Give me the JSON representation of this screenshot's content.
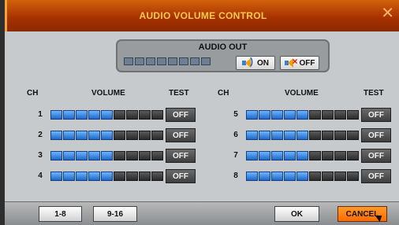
{
  "window": {
    "title": "AUDIO VOLUME CONTROL",
    "close_label": "✕"
  },
  "audio_out": {
    "label": "AUDIO OUT",
    "segments_total": 8,
    "segments_on": 0,
    "on_label": "ON",
    "off_label": "OFF"
  },
  "headers": {
    "ch": "CH",
    "volume": "VOLUME",
    "test": "TEST"
  },
  "channels": [
    {
      "ch": "1",
      "segments_on": 5,
      "segments_total": 9,
      "test": "OFF"
    },
    {
      "ch": "2",
      "segments_on": 5,
      "segments_total": 9,
      "test": "OFF"
    },
    {
      "ch": "3",
      "segments_on": 5,
      "segments_total": 9,
      "test": "OFF"
    },
    {
      "ch": "4",
      "segments_on": 5,
      "segments_total": 9,
      "test": "OFF"
    },
    {
      "ch": "5",
      "segments_on": 5,
      "segments_total": 9,
      "test": "OFF"
    },
    {
      "ch": "6",
      "segments_on": 5,
      "segments_total": 9,
      "test": "OFF"
    },
    {
      "ch": "7",
      "segments_on": 5,
      "segments_total": 9,
      "test": "OFF"
    },
    {
      "ch": "8",
      "segments_on": 5,
      "segments_total": 9,
      "test": "OFF"
    }
  ],
  "buttons": {
    "page_1_8": "1-8",
    "page_9_16": "9-16",
    "ok": "OK",
    "cancel": "CANCEL"
  },
  "icons": [
    "close-icon",
    "speaker-on-icon",
    "speaker-off-icon",
    "mouse-cursor-icon"
  ],
  "colors": {
    "titlebar": "#a83200",
    "title_text": "#ffc94d",
    "volume_on": "#2f86e6",
    "volume_off": "#3b3b3b",
    "cancel_bg": "#ff7a00"
  }
}
